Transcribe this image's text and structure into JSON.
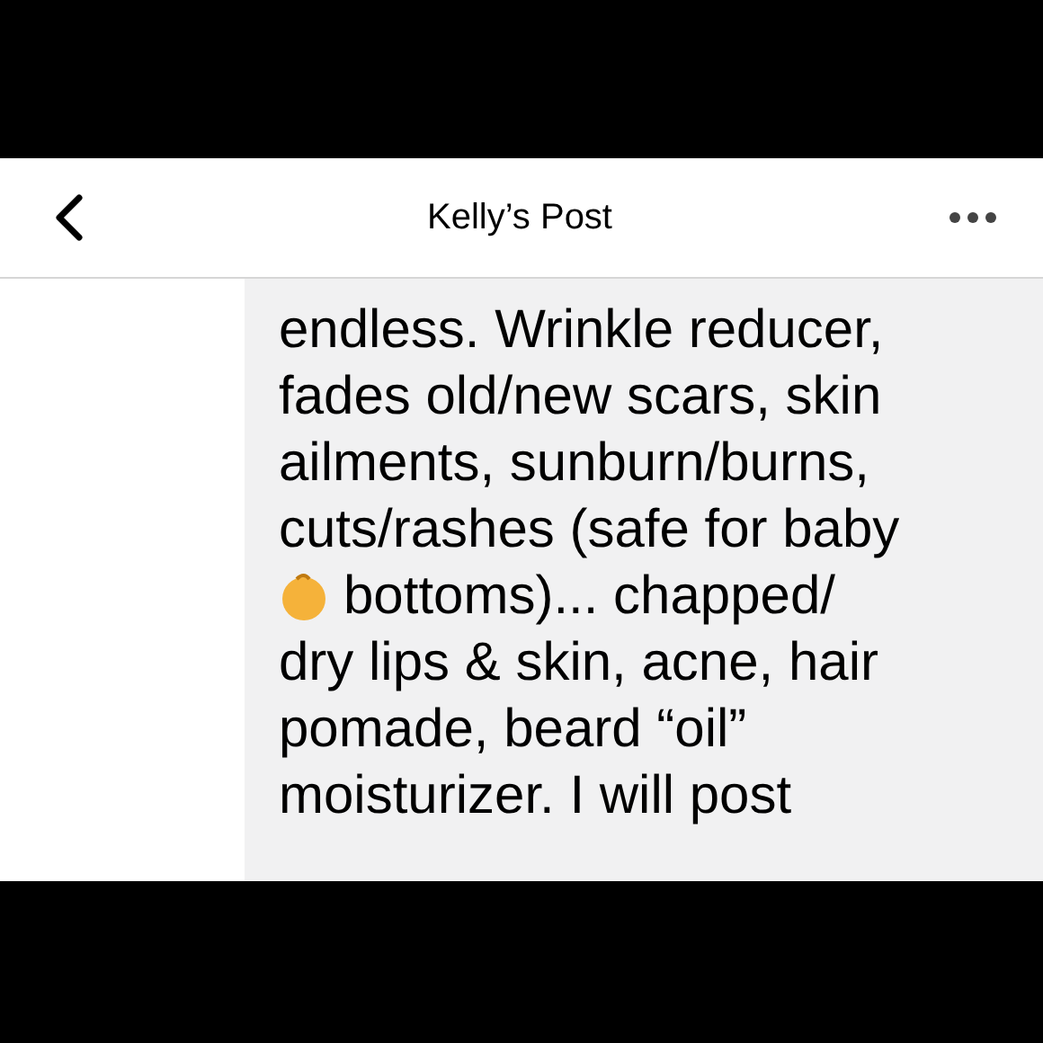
{
  "header": {
    "title": "Kelly’s Post"
  },
  "post": {
    "lines": [
      {
        "kind": "text",
        "text": "endless. Wrinkle reducer,"
      },
      {
        "kind": "text",
        "text": "fades old/new scars, skin"
      },
      {
        "kind": "text",
        "text": "ailments, sunburn/burns,"
      },
      {
        "kind": "text",
        "text": "cuts/rashes (safe for baby"
      },
      {
        "kind": "emoji",
        "text": "bottoms)... chapped/"
      },
      {
        "kind": "text",
        "text": "dry lips & skin, acne, hair"
      },
      {
        "kind": "text",
        "text": "pomade, beard “oil”"
      },
      {
        "kind": "text",
        "text": "moisturizer. I will post"
      }
    ]
  }
}
